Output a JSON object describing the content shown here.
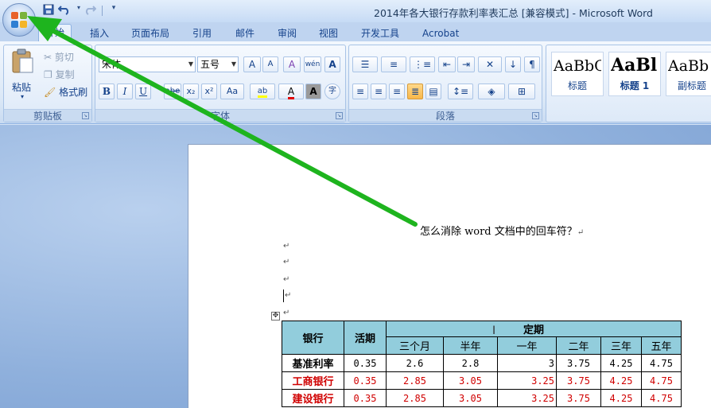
{
  "window": {
    "title": "2014年各大银行存款利率表汇总 [兼容模式] - Microsoft Word"
  },
  "quick_access": {
    "save_icon": "save-icon",
    "undo_icon": "undo-icon",
    "redo_icon": "redo-icon",
    "customize_icon": "chevron-down-icon"
  },
  "tabs": [
    {
      "label": "开始"
    },
    {
      "label": "插入"
    },
    {
      "label": "页面布局"
    },
    {
      "label": "引用"
    },
    {
      "label": "邮件"
    },
    {
      "label": "审阅"
    },
    {
      "label": "视图"
    },
    {
      "label": "开发工具"
    },
    {
      "label": "Acrobat"
    }
  ],
  "ribbon": {
    "clipboard": {
      "paste": "粘贴",
      "cut": "剪切",
      "copy": "复制",
      "format_painter": "格式刷",
      "label": "剪贴板"
    },
    "font": {
      "font_name": "宋体",
      "font_size": "五号",
      "label": "字体",
      "bold": "B",
      "italic": "I",
      "underline": "U",
      "strike": "abe",
      "subscript": "x₂",
      "superscript": "x²",
      "change_case": "Aa",
      "highlight": "ab",
      "font_color": "A",
      "char_shading": "A",
      "enclose": "字",
      "grow": "A",
      "shrink": "A",
      "clear": "A",
      "phonetic": "wén"
    },
    "paragraph": {
      "label": "段落"
    },
    "styles": [
      {
        "sample": "AaBbC",
        "name": "标题"
      },
      {
        "sample": "AaBl",
        "name": "标题 1"
      },
      {
        "sample": "AaBb",
        "name": "副标题"
      }
    ]
  },
  "document": {
    "question": "怎么消除 word 文档中的回车符？",
    "para_mark": "↵",
    "table": {
      "headers": {
        "bank": "银行",
        "demand": "活期",
        "fixed": "定期"
      },
      "sub_headers": [
        "三个月",
        "半年",
        "一年",
        "二年",
        "三年",
        "五年"
      ],
      "rows": [
        {
          "bank": "基准利率",
          "values": [
            "0.35",
            "2.6",
            "2.8",
            "3",
            "3.75",
            "4.25",
            "4.75"
          ],
          "highlight": false
        },
        {
          "bank": "工商银行",
          "values": [
            "0.35",
            "2.85",
            "3.05",
            "3.25",
            "3.75",
            "4.25",
            "4.75"
          ],
          "highlight": true
        },
        {
          "bank": "建设银行",
          "values": [
            "0.35",
            "2.85",
            "3.05",
            "3.25",
            "3.75",
            "4.25",
            "4.75"
          ],
          "highlight": true
        }
      ]
    }
  },
  "colors": {
    "annotation_arrow": "#1eb41e",
    "red_text": "#d00000",
    "table_header": "#92cddc"
  }
}
